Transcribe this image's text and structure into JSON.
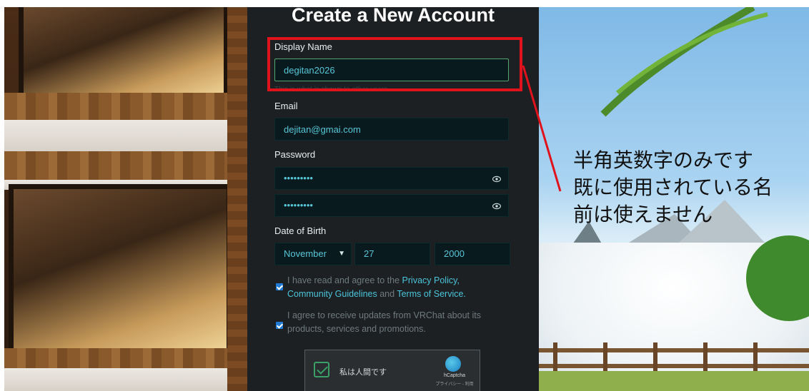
{
  "form": {
    "title": "Create a New Account",
    "display_name_label": "Display Name",
    "display_name_value": "degitan2026",
    "display_name_hint": "This is what is shown to other users",
    "email_label": "Email",
    "email_value": "dejitan@gmai.com",
    "password_label": "Password",
    "password_value": "•••••••••",
    "password_confirm_value": "•••••••••",
    "dob_label": "Date of Birth",
    "dob_month": "November",
    "dob_day": "27",
    "dob_year": "2000",
    "agree1_prefix": "I have read and agree to the",
    "agree1_link1": "Privacy Policy,",
    "agree1_link2": "Community Guidelines",
    "agree1_and": "and",
    "agree1_link3": "Terms of Service.",
    "agree2": "I agree to receive updates from VRChat about its products, services and promotions.",
    "captcha_label": "私は人間です",
    "captcha_brand": "hCaptcha",
    "captcha_sub": "プライバシー - 利用"
  },
  "annotation": {
    "line1": "半角英数字のみです",
    "line2": "既に使用されている名",
    "line3": "前は使えません"
  },
  "colors": {
    "panel_bg": "#1c2022",
    "input_bg": "#081a1d",
    "value_text": "#55c7d7",
    "link": "#4cc4da",
    "checkbox": "#1f7bd6",
    "highlight": "#e0121c"
  },
  "icons": [
    "eye-icon",
    "chevron-down-icon",
    "checkbox-check-icon",
    "hcaptcha-logo-icon"
  ]
}
